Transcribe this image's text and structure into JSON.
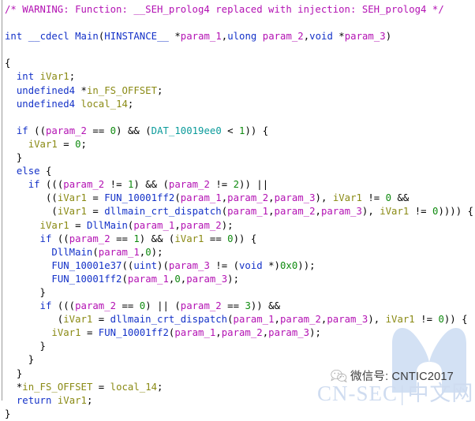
{
  "app": {
    "name": "Ghidra Decompiler",
    "view": "decompiler-output"
  },
  "theme": {
    "background": "#ffffff",
    "comment_color": "#b312b3",
    "keyword_color": "#1432c8",
    "function_color": "#1432c8",
    "variable_color": "#8a8a14",
    "parameter_color": "#b312b3",
    "global_color": "#0b9b9b",
    "constant_color": "#0f8a0f",
    "plain_color": "#000000"
  },
  "code": {
    "language": "c",
    "function_name": "Main",
    "lines": [
      [
        {
          "t": "comment",
          "s": "/* WARNING: Function: __SEH_prolog4 replaced with injection: SEH_prolog4 */"
        }
      ],
      [],
      [
        {
          "t": "type",
          "s": "int"
        },
        {
          "t": "plain",
          "s": " "
        },
        {
          "t": "keyword",
          "s": "__cdecl"
        },
        {
          "t": "plain",
          "s": " "
        },
        {
          "t": "funcname",
          "s": "Main"
        },
        {
          "t": "plain",
          "s": "("
        },
        {
          "t": "type",
          "s": "HINSTANCE__"
        },
        {
          "t": "plain",
          "s": " *"
        },
        {
          "t": "param",
          "s": "param_1"
        },
        {
          "t": "plain",
          "s": ","
        },
        {
          "t": "type",
          "s": "ulong"
        },
        {
          "t": "plain",
          "s": " "
        },
        {
          "t": "param",
          "s": "param_2"
        },
        {
          "t": "plain",
          "s": ","
        },
        {
          "t": "type",
          "s": "void"
        },
        {
          "t": "plain",
          "s": " *"
        },
        {
          "t": "param",
          "s": "param_3"
        },
        {
          "t": "plain",
          "s": ")"
        }
      ],
      [],
      [
        {
          "t": "plain",
          "s": "{"
        }
      ],
      [
        {
          "t": "plain",
          "s": "  "
        },
        {
          "t": "type",
          "s": "int"
        },
        {
          "t": "plain",
          "s": " "
        },
        {
          "t": "var",
          "s": "iVar1"
        },
        {
          "t": "plain",
          "s": ";"
        }
      ],
      [
        {
          "t": "plain",
          "s": "  "
        },
        {
          "t": "type",
          "s": "undefined4"
        },
        {
          "t": "plain",
          "s": " *"
        },
        {
          "t": "var",
          "s": "in_FS_OFFSET"
        },
        {
          "t": "plain",
          "s": ";"
        }
      ],
      [
        {
          "t": "plain",
          "s": "  "
        },
        {
          "t": "type",
          "s": "undefined4"
        },
        {
          "t": "plain",
          "s": " "
        },
        {
          "t": "var",
          "s": "local_14"
        },
        {
          "t": "plain",
          "s": ";"
        }
      ],
      [],
      [
        {
          "t": "plain",
          "s": "  "
        },
        {
          "t": "keyword",
          "s": "if"
        },
        {
          "t": "plain",
          "s": " (("
        },
        {
          "t": "param",
          "s": "param_2"
        },
        {
          "t": "plain",
          "s": " == "
        },
        {
          "t": "const",
          "s": "0"
        },
        {
          "t": "plain",
          "s": ") && ("
        },
        {
          "t": "global",
          "s": "DAT_10019ee0"
        },
        {
          "t": "plain",
          "s": " < "
        },
        {
          "t": "const",
          "s": "1"
        },
        {
          "t": "plain",
          "s": ")) {"
        }
      ],
      [
        {
          "t": "plain",
          "s": "    "
        },
        {
          "t": "var",
          "s": "iVar1"
        },
        {
          "t": "plain",
          "s": " = "
        },
        {
          "t": "const",
          "s": "0"
        },
        {
          "t": "plain",
          "s": ";"
        }
      ],
      [
        {
          "t": "plain",
          "s": "  }"
        }
      ],
      [
        {
          "t": "plain",
          "s": "  "
        },
        {
          "t": "keyword",
          "s": "else"
        },
        {
          "t": "plain",
          "s": " {"
        }
      ],
      [
        {
          "t": "plain",
          "s": "    "
        },
        {
          "t": "keyword",
          "s": "if"
        },
        {
          "t": "plain",
          "s": " ((("
        },
        {
          "t": "param",
          "s": "param_2"
        },
        {
          "t": "plain",
          "s": " != "
        },
        {
          "t": "const",
          "s": "1"
        },
        {
          "t": "plain",
          "s": ") && ("
        },
        {
          "t": "param",
          "s": "param_2"
        },
        {
          "t": "plain",
          "s": " != "
        },
        {
          "t": "const",
          "s": "2"
        },
        {
          "t": "plain",
          "s": ")) ||"
        }
      ],
      [
        {
          "t": "plain",
          "s": "       (("
        },
        {
          "t": "var",
          "s": "iVar1"
        },
        {
          "t": "plain",
          "s": " = "
        },
        {
          "t": "funcname",
          "s": "FUN_10001ff2"
        },
        {
          "t": "plain",
          "s": "("
        },
        {
          "t": "param",
          "s": "param_1"
        },
        {
          "t": "plain",
          "s": ","
        },
        {
          "t": "param",
          "s": "param_2"
        },
        {
          "t": "plain",
          "s": ","
        },
        {
          "t": "param",
          "s": "param_3"
        },
        {
          "t": "plain",
          "s": "), "
        },
        {
          "t": "var",
          "s": "iVar1"
        },
        {
          "t": "plain",
          "s": " != "
        },
        {
          "t": "const",
          "s": "0"
        },
        {
          "t": "plain",
          "s": " &&"
        }
      ],
      [
        {
          "t": "plain",
          "s": "        ("
        },
        {
          "t": "var",
          "s": "iVar1"
        },
        {
          "t": "plain",
          "s": " = "
        },
        {
          "t": "funcname",
          "s": "dllmain_crt_dispatch"
        },
        {
          "t": "plain",
          "s": "("
        },
        {
          "t": "param",
          "s": "param_1"
        },
        {
          "t": "plain",
          "s": ","
        },
        {
          "t": "param",
          "s": "param_2"
        },
        {
          "t": "plain",
          "s": ","
        },
        {
          "t": "param",
          "s": "param_3"
        },
        {
          "t": "plain",
          "s": "), "
        },
        {
          "t": "var",
          "s": "iVar1"
        },
        {
          "t": "plain",
          "s": " != "
        },
        {
          "t": "const",
          "s": "0"
        },
        {
          "t": "plain",
          "s": ")))) {"
        }
      ],
      [
        {
          "t": "plain",
          "s": "      "
        },
        {
          "t": "var",
          "s": "iVar1"
        },
        {
          "t": "plain",
          "s": " = "
        },
        {
          "t": "funcname",
          "s": "DllMain"
        },
        {
          "t": "plain",
          "s": "("
        },
        {
          "t": "param",
          "s": "param_1"
        },
        {
          "t": "plain",
          "s": ","
        },
        {
          "t": "param",
          "s": "param_2"
        },
        {
          "t": "plain",
          "s": ");"
        }
      ],
      [
        {
          "t": "plain",
          "s": "      "
        },
        {
          "t": "keyword",
          "s": "if"
        },
        {
          "t": "plain",
          "s": " (("
        },
        {
          "t": "param",
          "s": "param_2"
        },
        {
          "t": "plain",
          "s": " == "
        },
        {
          "t": "const",
          "s": "1"
        },
        {
          "t": "plain",
          "s": ") && ("
        },
        {
          "t": "var",
          "s": "iVar1"
        },
        {
          "t": "plain",
          "s": " == "
        },
        {
          "t": "const",
          "s": "0"
        },
        {
          "t": "plain",
          "s": ")) {"
        }
      ],
      [
        {
          "t": "plain",
          "s": "        "
        },
        {
          "t": "funcname",
          "s": "DllMain"
        },
        {
          "t": "plain",
          "s": "("
        },
        {
          "t": "param",
          "s": "param_1"
        },
        {
          "t": "plain",
          "s": ","
        },
        {
          "t": "const",
          "s": "0"
        },
        {
          "t": "plain",
          "s": ");"
        }
      ],
      [
        {
          "t": "plain",
          "s": "        "
        },
        {
          "t": "funcname",
          "s": "FUN_10001e37"
        },
        {
          "t": "plain",
          "s": "(("
        },
        {
          "t": "type",
          "s": "uint"
        },
        {
          "t": "plain",
          "s": ")("
        },
        {
          "t": "param",
          "s": "param_3"
        },
        {
          "t": "plain",
          "s": " != ("
        },
        {
          "t": "type",
          "s": "void"
        },
        {
          "t": "plain",
          "s": " *)"
        },
        {
          "t": "const",
          "s": "0x0"
        },
        {
          "t": "plain",
          "s": "));"
        }
      ],
      [
        {
          "t": "plain",
          "s": "        "
        },
        {
          "t": "funcname",
          "s": "FUN_10001ff2"
        },
        {
          "t": "plain",
          "s": "("
        },
        {
          "t": "param",
          "s": "param_1"
        },
        {
          "t": "plain",
          "s": ","
        },
        {
          "t": "const",
          "s": "0"
        },
        {
          "t": "plain",
          "s": ","
        },
        {
          "t": "param",
          "s": "param_3"
        },
        {
          "t": "plain",
          "s": ");"
        }
      ],
      [
        {
          "t": "plain",
          "s": "      }"
        }
      ],
      [
        {
          "t": "plain",
          "s": "      "
        },
        {
          "t": "keyword",
          "s": "if"
        },
        {
          "t": "plain",
          "s": " ((("
        },
        {
          "t": "param",
          "s": "param_2"
        },
        {
          "t": "plain",
          "s": " == "
        },
        {
          "t": "const",
          "s": "0"
        },
        {
          "t": "plain",
          "s": ") || ("
        },
        {
          "t": "param",
          "s": "param_2"
        },
        {
          "t": "plain",
          "s": " == "
        },
        {
          "t": "const",
          "s": "3"
        },
        {
          "t": "plain",
          "s": ")) &&"
        }
      ],
      [
        {
          "t": "plain",
          "s": "         ("
        },
        {
          "t": "var",
          "s": "iVar1"
        },
        {
          "t": "plain",
          "s": " = "
        },
        {
          "t": "funcname",
          "s": "dllmain_crt_dispatch"
        },
        {
          "t": "plain",
          "s": "("
        },
        {
          "t": "param",
          "s": "param_1"
        },
        {
          "t": "plain",
          "s": ","
        },
        {
          "t": "param",
          "s": "param_2"
        },
        {
          "t": "plain",
          "s": ","
        },
        {
          "t": "param",
          "s": "param_3"
        },
        {
          "t": "plain",
          "s": "), "
        },
        {
          "t": "var",
          "s": "iVar1"
        },
        {
          "t": "plain",
          "s": " != "
        },
        {
          "t": "const",
          "s": "0"
        },
        {
          "t": "plain",
          "s": ")) {"
        }
      ],
      [
        {
          "t": "plain",
          "s": "        "
        },
        {
          "t": "var",
          "s": "iVar1"
        },
        {
          "t": "plain",
          "s": " = "
        },
        {
          "t": "funcname",
          "s": "FUN_10001ff2"
        },
        {
          "t": "plain",
          "s": "("
        },
        {
          "t": "param",
          "s": "param_1"
        },
        {
          "t": "plain",
          "s": ","
        },
        {
          "t": "param",
          "s": "param_2"
        },
        {
          "t": "plain",
          "s": ","
        },
        {
          "t": "param",
          "s": "param_3"
        },
        {
          "t": "plain",
          "s": ");"
        }
      ],
      [
        {
          "t": "plain",
          "s": "      }"
        }
      ],
      [
        {
          "t": "plain",
          "s": "    }"
        }
      ],
      [
        {
          "t": "plain",
          "s": "  }"
        }
      ],
      [
        {
          "t": "plain",
          "s": "  *"
        },
        {
          "t": "var",
          "s": "in_FS_OFFSET"
        },
        {
          "t": "plain",
          "s": " = "
        },
        {
          "t": "var",
          "s": "local_14"
        },
        {
          "t": "plain",
          "s": ";"
        }
      ],
      [
        {
          "t": "plain",
          "s": "  "
        },
        {
          "t": "keyword",
          "s": "return"
        },
        {
          "t": "plain",
          "s": " "
        },
        {
          "t": "var",
          "s": "iVar1"
        },
        {
          "t": "plain",
          "s": ";"
        }
      ],
      [
        {
          "t": "plain",
          "s": "}"
        }
      ]
    ]
  },
  "watermarks": {
    "wechat_label": "微信号: CNTIC2017",
    "site_name_left": "CN-SEC",
    "site_divider": "|",
    "site_name_right": "中文网",
    "logo_color": "#b9cfee",
    "site_text_color": "#cfdcf0"
  }
}
